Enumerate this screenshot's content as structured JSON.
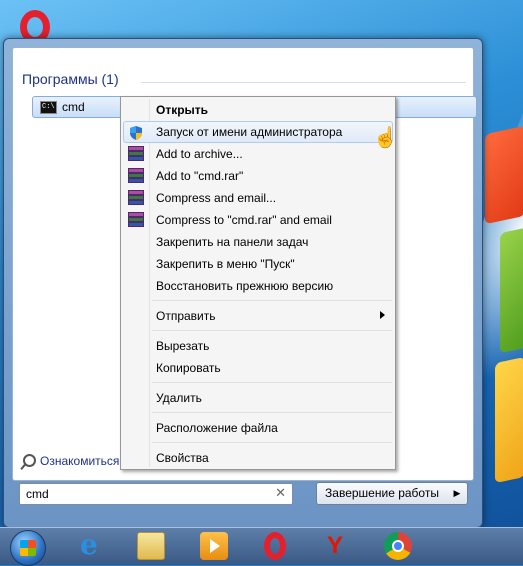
{
  "start_menu": {
    "section_title": "Программы (1)",
    "program": {
      "label": "cmd",
      "icon": "console-icon"
    },
    "see_more": "Ознакомиться с",
    "search": {
      "value": "cmd",
      "clear": "✕"
    },
    "shutdown_label": "Завершение работы",
    "shutdown_arrow": "▶"
  },
  "context_menu": {
    "items": [
      {
        "label": "Открыть",
        "bold": true
      },
      {
        "label": "Запуск от имени администратора",
        "icon": "uac-shield-icon"
      },
      {
        "label": "Add to archive...",
        "icon": "winrar-icon"
      },
      {
        "label": "Add to \"cmd.rar\"",
        "icon": "winrar-icon"
      },
      {
        "label": "Compress and email...",
        "icon": "winrar-icon"
      },
      {
        "label": "Compress to \"cmd.rar\" and email",
        "icon": "winrar-icon"
      },
      {
        "label": "Закрепить на панели задач"
      },
      {
        "label": "Закрепить в меню \"Пуск\""
      },
      {
        "label": "Восстановить прежнюю версию"
      },
      {
        "label": "Отправить",
        "submenu": true
      },
      {
        "label": "Вырезать"
      },
      {
        "label": "Копировать"
      },
      {
        "label": "Удалить"
      },
      {
        "label": "Расположение файла"
      },
      {
        "label": "Свойства"
      }
    ]
  },
  "taskbar": {
    "items": [
      "start-orb",
      "internet-explorer-icon",
      "explorer-folder-icon",
      "media-player-icon",
      "opera-icon",
      "yandex-browser-icon",
      "chrome-icon"
    ]
  },
  "cursor": "hand-pointer-icon"
}
